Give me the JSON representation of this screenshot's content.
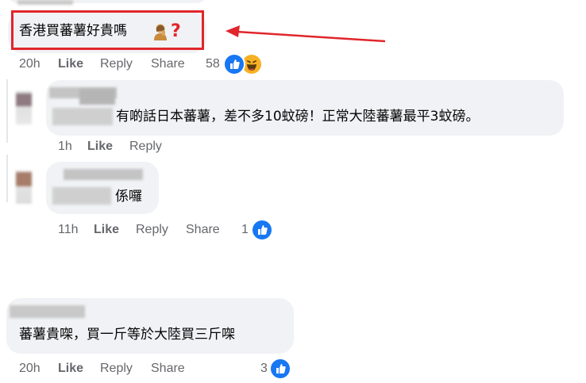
{
  "comments": [
    {
      "text": "香港買蕃薯好貴嗎",
      "time": "20h",
      "like": "Like",
      "reply": "Reply",
      "share": "Share",
      "reactions": "58"
    },
    {
      "text": "有啲話日本蕃薯，差不多10蚊磅！正常大陸蕃薯最平3蚊磅。",
      "time": "1h",
      "like": "Like",
      "reply": "Reply"
    },
    {
      "text": "係囉",
      "time": "11h",
      "like": "Like",
      "reply": "Reply",
      "share": "Share",
      "reactions": "1"
    },
    {
      "text": "蕃薯貴㗎，買一斤等於大陸買三斤㗎",
      "time": "20h",
      "like": "Like",
      "reply": "Reply",
      "share": "Share",
      "reactions": "3"
    }
  ],
  "colors": {
    "highlight": "#e0262c",
    "like_blue": "#1877f2",
    "bubble": "#f0f2f5",
    "meta": "#65676b"
  },
  "icons": [
    "person-question-emoji",
    "question-mark-emoji",
    "like-reaction-icon",
    "haha-reaction-icon"
  ]
}
